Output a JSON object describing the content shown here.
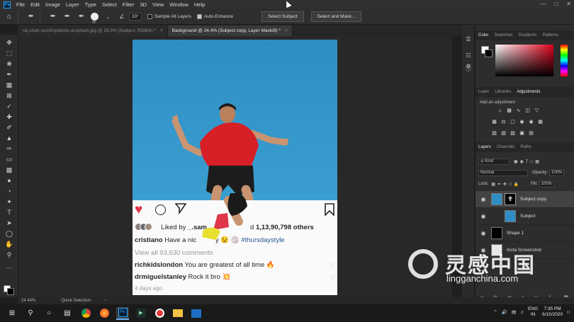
{
  "app": {
    "logo": "Ps"
  },
  "menubar": {
    "items": [
      "File",
      "Edit",
      "Image",
      "Layer",
      "Type",
      "Select",
      "Filter",
      "3D",
      "View",
      "Window",
      "Help"
    ]
  },
  "options": {
    "brush_size": "45",
    "angle": "33°",
    "sample_all_layers": "Sample All Layers",
    "sample_all_layers_checked": false,
    "auto_enhance": "Auto-Enhance",
    "auto_enhance_checked": true,
    "select_subject": "Select Subject",
    "select_and_mask": "Select and Mask..."
  },
  "tabs": [
    {
      "label": "raj-shah-sum0Apdexto-unsplash.jpg @ 26.5% (Subject, RGB/8) *",
      "active": false
    },
    {
      "label": "Background @ 24.4% (Subject copy, Layer Mask/8) *",
      "active": true
    }
  ],
  "instagram": {
    "liked_by_prefix": "Liked by ",
    "liked_by_user": "_.sam",
    "liked_by_and": "d ",
    "liked_count": "1,13,90,798 others",
    "caption_user": "cristiano",
    "caption_text": " Have a nic",
    "caption_mid": "y 😉 🏐 ",
    "caption_tag": "#thursdaystyle",
    "view_comments": "View all 93,630 comments",
    "comment1_user": "richkidslondon",
    "comment1_text": " You are greatest of all time 🔥",
    "comment2_user": "drmiguelstanley",
    "comment2_text": " Rock it bro 💥",
    "time_ago": "4 days ago"
  },
  "panels": {
    "color_tabs": [
      "Color",
      "Swatches",
      "Gradients",
      "Patterns"
    ],
    "adj_tabs": [
      "Learn",
      "Libraries",
      "Adjustments"
    ],
    "adj_label": "Add an adjustment",
    "layer_tabs": [
      "Layers",
      "Channels",
      "Paths"
    ],
    "kind": "Kind",
    "blend_mode": "Normal",
    "opacity_label": "Opacity:",
    "opacity_value": "100%",
    "lock_label": "Lock:",
    "fill_label": "Fill:",
    "fill_value": "100%",
    "layers": [
      {
        "name": "Subject copy",
        "selected": true
      },
      {
        "name": "Subject",
        "selected": false
      },
      {
        "name": "Shape 1",
        "selected": false
      },
      {
        "name": "Insta Screenshot",
        "selected": false
      }
    ]
  },
  "statusbar": {
    "zoom": "24.44%",
    "tool": "Quick Selection"
  },
  "tray": {
    "lang1": "ENG",
    "lang2": "IN",
    "time": "7:35 PM",
    "date": "6/15/2020"
  },
  "watermark": {
    "cn": "灵感中国",
    "url": "lingganchina.com"
  },
  "colors": {
    "photo_sky": "#2e8ec3",
    "shirt": "#d61f26",
    "ig_heart": "#e0364a",
    "accent": "#31a8ff"
  }
}
